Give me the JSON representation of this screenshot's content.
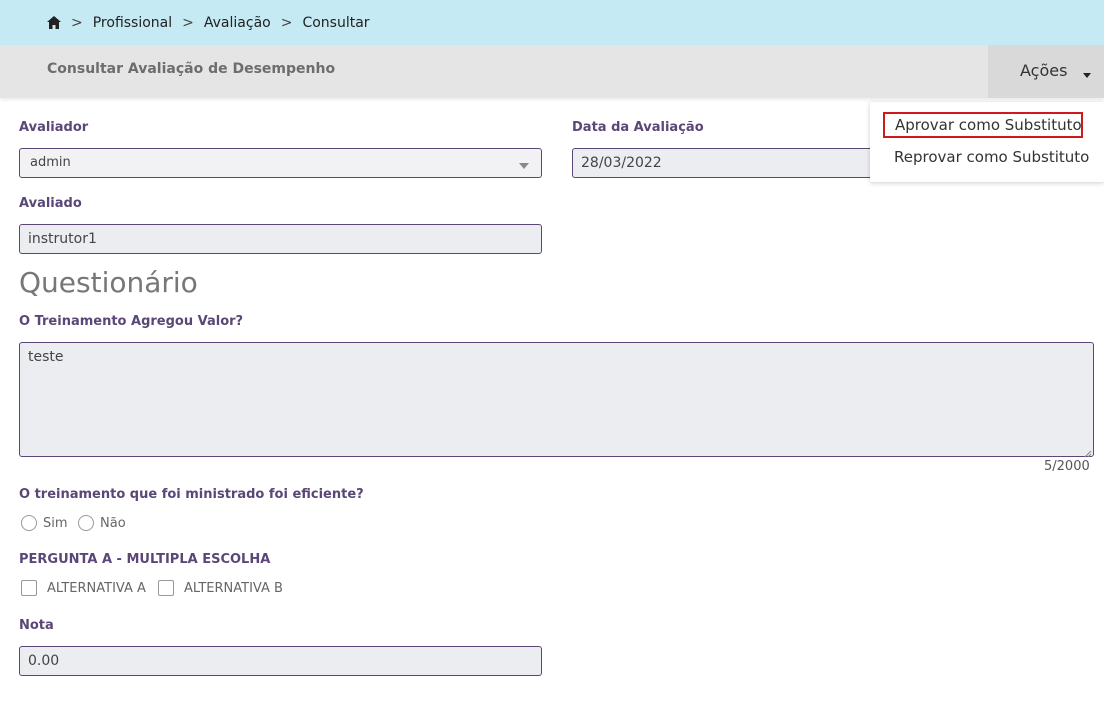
{
  "breadcrumb": {
    "home_icon": "home-icon",
    "items": [
      "Profissional",
      "Avaliação",
      "Consultar"
    ],
    "separator": ">"
  },
  "header": {
    "title": "Consultar Avaliação de Desempenho",
    "actions_label": "Ações"
  },
  "actions_menu": {
    "items": [
      "Aprovar como Substituto",
      "Reprovar como Substituto"
    ]
  },
  "form": {
    "avaliador": {
      "label": "Avaliador",
      "value": "admin"
    },
    "data_avaliacao": {
      "label": "Data da Avaliação",
      "value": "28/03/2022"
    },
    "avaliado": {
      "label": "Avaliado",
      "value": "instrutor1"
    }
  },
  "questionario": {
    "title": "Questionário",
    "q1": {
      "label": "O Treinamento Agregou Valor?",
      "value": "teste",
      "counter": "5/2000"
    },
    "q2": {
      "label": "O treinamento que foi ministrado foi eficiente?",
      "options": [
        "Sim",
        "Não"
      ]
    },
    "q3": {
      "label": "PERGUNTA A - MULTIPLA ESCOLHA",
      "options": [
        "ALTERNATIVA A",
        "ALTERNATIVA B"
      ]
    },
    "nota": {
      "label": "Nota",
      "value": "0.00"
    }
  },
  "colors": {
    "breadcrumb_bg": "#c6eaf4",
    "label_color": "#5a4777",
    "highlight_border": "#d0191c"
  }
}
